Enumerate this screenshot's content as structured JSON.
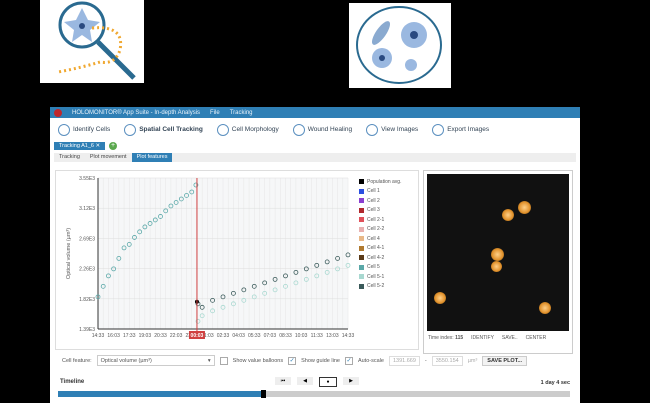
{
  "app": {
    "title": "HOLOMONITOR® App Suite - In-depth Analysis",
    "menus": [
      "File",
      "Tracking"
    ]
  },
  "toolbar": [
    "Identify Cells",
    "Spatial Cell Tracking",
    "Cell Morphology",
    "Wound Healing",
    "View Images",
    "Export Images"
  ],
  "doc_tab": "Tracking A1_6  ✕",
  "subtabs": [
    "Tracking",
    "Plot movement",
    "Plot features"
  ],
  "legend": [
    {
      "name": "Population avg.",
      "color": "#000000"
    },
    {
      "name": "Cell 1",
      "color": "#2b4fe0"
    },
    {
      "name": "Cell 2",
      "color": "#8a3fd0"
    },
    {
      "name": "Cell 3",
      "color": "#b0282d"
    },
    {
      "name": "Cell 2-1",
      "color": "#e0505a"
    },
    {
      "name": "Cell 2-2",
      "color": "#e8b0b0"
    },
    {
      "name": "Cell 4",
      "color": "#e8b888"
    },
    {
      "name": "Cell 4-1",
      "color": "#b07a30"
    },
    {
      "name": "Cell 4-2",
      "color": "#5a3a18"
    },
    {
      "name": "Cell 5",
      "color": "#5aa8a8"
    },
    {
      "name": "Cell 5-1",
      "color": "#a8d8d0"
    },
    {
      "name": "Cell 5-2",
      "color": "#3a5a5a"
    }
  ],
  "chart_data": {
    "type": "scatter",
    "ylabel": "Optical volume (µm³)",
    "ylim": [
      1390,
      3550
    ],
    "yticks": [
      "3.55E3",
      "3.12E3",
      "2.69E3",
      "2.26E3",
      "1.82E3",
      "1.39E3"
    ],
    "xticks": [
      "14:33",
      "16:03",
      "17:33",
      "19:03",
      "20:33",
      "22:03",
      "23:33",
      "01:03",
      "02:33",
      "04:03",
      "05:33",
      "07:03",
      "08:33",
      "10:03",
      "11:33",
      "13:03",
      "14:33"
    ],
    "xlim_hours": [
      0,
      24
    ],
    "guide_time": "00:03",
    "guide_hours": 9.5,
    "series": [
      {
        "name": "Cell 5",
        "color": "#5aa8a8",
        "x": [
          0,
          0.5,
          1,
          1.5,
          2,
          2.5,
          3,
          3.5,
          4,
          4.5,
          5,
          5.5,
          6,
          6.5,
          7,
          7.5,
          8,
          8.5,
          9,
          9.4
        ],
        "y": [
          1850,
          2000,
          2150,
          2250,
          2400,
          2550,
          2600,
          2700,
          2780,
          2850,
          2900,
          2950,
          3000,
          3080,
          3150,
          3200,
          3250,
          3300,
          3350,
          3450
        ]
      },
      {
        "name": "Cell 5-1",
        "color": "#a8d8d0",
        "x": [
          9.6,
          10,
          11,
          12,
          13,
          14,
          15,
          16,
          17,
          18,
          19,
          20,
          21,
          22,
          23,
          24
        ],
        "y": [
          1500,
          1580,
          1650,
          1700,
          1750,
          1800,
          1850,
          1900,
          1950,
          2000,
          2050,
          2100,
          2150,
          2200,
          2250,
          2300
        ]
      },
      {
        "name": "Cell 5-2",
        "color": "#3a5a5a",
        "x": [
          9.6,
          10,
          11,
          12,
          13,
          14,
          15,
          16,
          17,
          18,
          19,
          20,
          21,
          22,
          23,
          24
        ],
        "y": [
          1750,
          1700,
          1800,
          1850,
          1900,
          1950,
          2000,
          2050,
          2100,
          2150,
          2200,
          2250,
          2300,
          2350,
          2400,
          2450
        ]
      },
      {
        "name": "Population avg.",
        "color": "#000000",
        "x": [
          9.5
        ],
        "y": [
          1780
        ]
      }
    ]
  },
  "image_panel": {
    "time_index_label": "Time index:",
    "time_index": "115",
    "identify": "IDENTIFY",
    "save": "SAVE..",
    "center": "CENTER"
  },
  "controls": {
    "cell_feature_label": "Cell feature:",
    "cell_feature": "Optical volume (µm³)",
    "show_balloons": "Show value balloons",
    "show_guide": "Show guide line",
    "auto_scale": "Auto-scale",
    "min": "1391.669",
    "max": "3550.154",
    "unit": "µm³",
    "save_plot": "SAVE PLOT..."
  },
  "timeline": {
    "label": "Timeline",
    "duration": "1 day 4 sec",
    "progress": 0.4
  }
}
